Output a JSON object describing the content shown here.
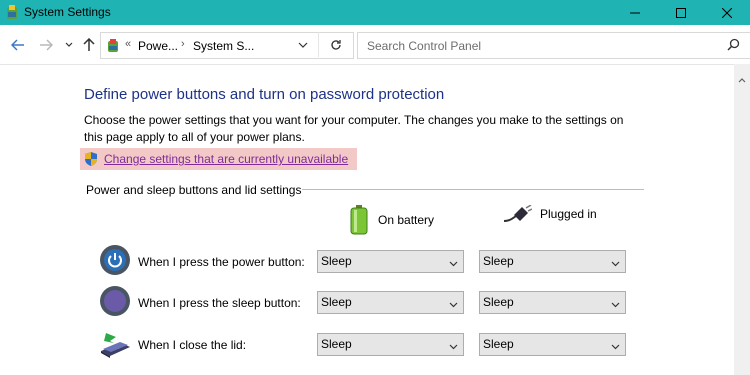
{
  "window": {
    "title": "System Settings"
  },
  "nav": {
    "breadcrumb": [
      "Powe...",
      "System S..."
    ],
    "search_placeholder": "Search Control Panel"
  },
  "content": {
    "heading": "Define power buttons and turn on password protection",
    "description": "Choose the power settings that you want for your computer. The changes you make to the settings on this page apply to all of your power plans.",
    "change_link": "Change settings that are currently unavailable",
    "section_title": "Power and sleep buttons and lid settings",
    "columns": {
      "battery": "On battery",
      "plugged": "Plugged in"
    },
    "rows": [
      {
        "label": "When I press the power button:",
        "battery": "Sleep",
        "plugged": "Sleep",
        "icon": "power-button-icon"
      },
      {
        "label": "When I press the sleep button:",
        "battery": "Sleep",
        "plugged": "Sleep",
        "icon": "sleep-button-icon"
      },
      {
        "label": "When I close the lid:",
        "battery": "Sleep",
        "plugged": "Sleep",
        "icon": "laptop-lid-icon"
      }
    ]
  },
  "colors": {
    "titlebar": "#1fb3b3",
    "heading": "#1e3287",
    "link": "#7f2c9a",
    "highlight": "#f3c9c8"
  }
}
